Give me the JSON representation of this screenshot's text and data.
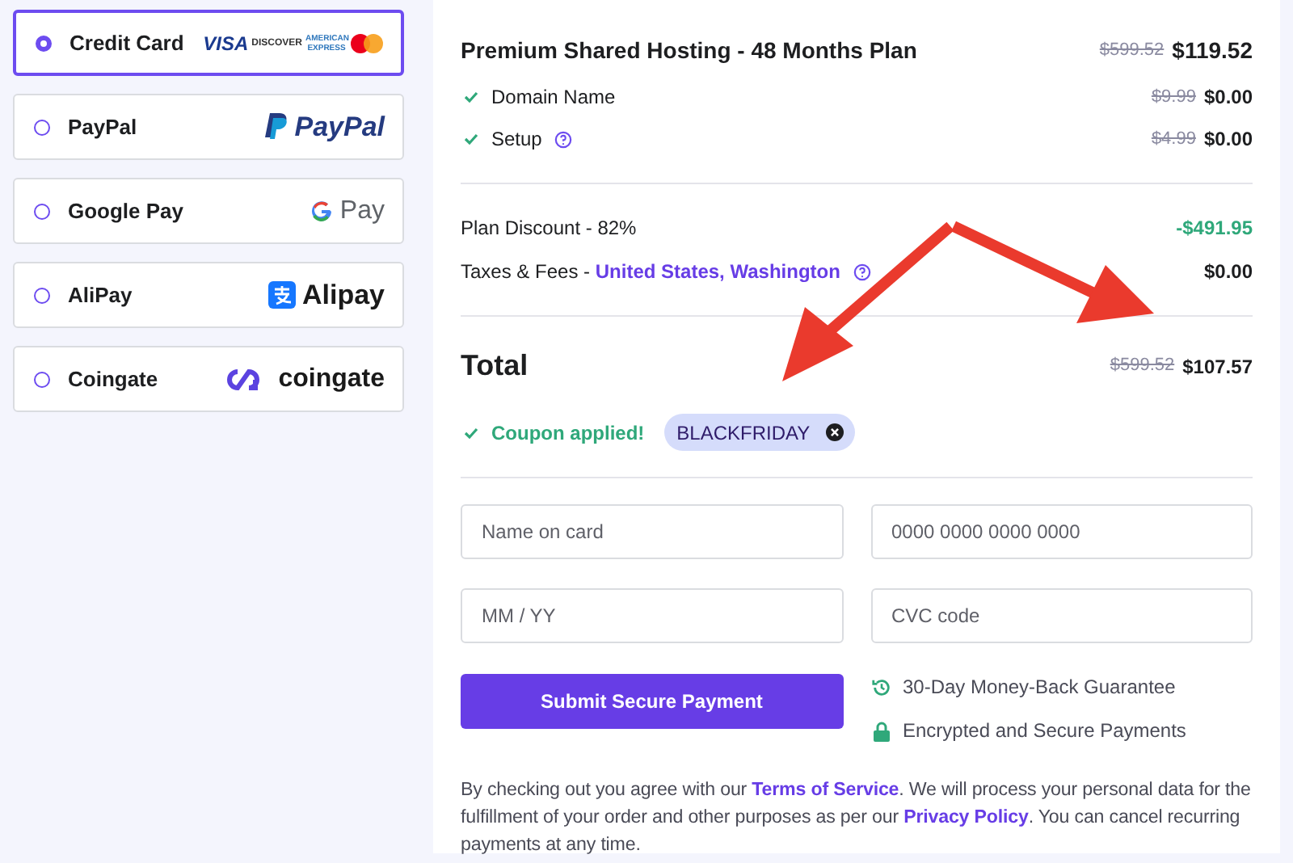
{
  "payment_methods": [
    {
      "label": "Credit Card",
      "selected": true,
      "logos": [
        {
          "kind": "visa",
          "text": "VISA"
        },
        {
          "kind": "discover",
          "text": "DISCOVER"
        },
        {
          "kind": "amex",
          "text": "AMERICAN EXPRESS"
        },
        {
          "kind": "mastercard"
        }
      ]
    },
    {
      "label": "PayPal",
      "selected": false,
      "logos": [
        {
          "kind": "paypal",
          "text": "PayPal"
        }
      ]
    },
    {
      "label": "Google Pay",
      "selected": false,
      "logos": [
        {
          "kind": "gpay",
          "text": "Pay"
        }
      ]
    },
    {
      "label": "AliPay",
      "selected": false,
      "logos": [
        {
          "kind": "alipay",
          "text": "Alipay"
        }
      ]
    },
    {
      "label": "Coingate",
      "selected": false,
      "logos": [
        {
          "kind": "coingate",
          "text": "coingate"
        }
      ]
    }
  ],
  "order": {
    "plan": {
      "name": "Premium Shared Hosting - 48 Months Plan",
      "old_price": "$599.52",
      "price": "$119.52"
    },
    "items": [
      {
        "name": "Domain Name",
        "help": false,
        "old_price": "$9.99",
        "price": "$0.00"
      },
      {
        "name": "Setup",
        "help": true,
        "old_price": "$4.99",
        "price": "$0.00"
      }
    ],
    "discount": {
      "label": "Plan Discount - 82%",
      "amount": "-$491.95"
    },
    "taxes": {
      "label": "Taxes & Fees - ",
      "region": "United States, Washington",
      "amount": "$0.00"
    },
    "total": {
      "label": "Total",
      "old_price": "$599.52",
      "price": "$107.57"
    },
    "coupon": {
      "status": "Coupon applied!",
      "code": "BLACKFRIDAY"
    }
  },
  "form": {
    "fields": [
      {
        "placeholder": "Name on card"
      },
      {
        "placeholder": "0000 0000 0000 0000"
      },
      {
        "placeholder": "MM / YY"
      },
      {
        "placeholder": "CVC code"
      }
    ],
    "submit": "Submit Secure Payment",
    "assurances": [
      {
        "kind": "history",
        "text": "30-Day Money-Back Guarantee"
      },
      {
        "kind": "lock",
        "text": "Encrypted and Secure Payments"
      }
    ],
    "terms": [
      {
        "kind": "text",
        "text": "By checking out you agree with our "
      },
      {
        "kind": "link",
        "text": "Terms of Service"
      },
      {
        "kind": "text",
        "text": ". We will process your personal data for the fulfillment of your order and other purposes as per our "
      },
      {
        "kind": "link",
        "text": "Privacy Policy"
      },
      {
        "kind": "text",
        "text": ". You can cancel recurring payments at any time."
      }
    ]
  }
}
